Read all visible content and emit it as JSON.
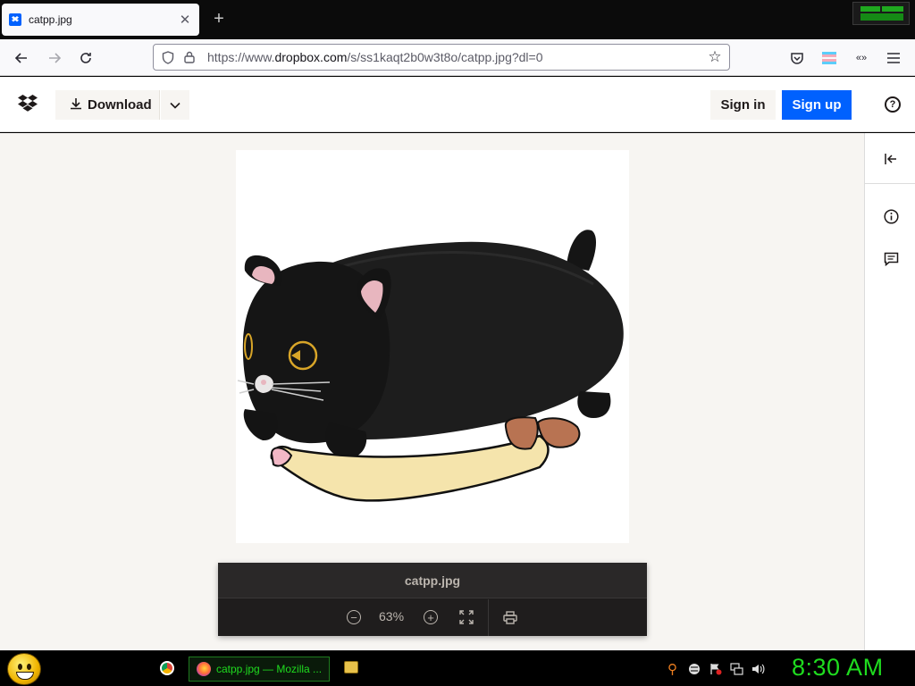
{
  "browser": {
    "tab_title": "catpp.jpg",
    "tab_close_glyph": "✕",
    "new_tab_glyph": "+",
    "url_prefix": "https://www.",
    "url_host": "dropbox.com",
    "url_path": "/s/ss1kaqt2b0w3t8o/catpp.jpg?dl=0"
  },
  "header": {
    "download_label": "Download",
    "sign_in_label": "Sign in",
    "sign_up_label": "Sign up",
    "help_glyph": "?"
  },
  "viewer": {
    "file_name": "catpp.jpg",
    "zoom_level": "63%"
  },
  "taskbar": {
    "firefox_label": "catpp.jpg — Mozilla ...",
    "clock": "8:30 AM"
  },
  "colors": {
    "dropbox_blue": "#0061fe",
    "taskbar_green": "#1fdc1f",
    "viewer_dark": "#1f1d1d"
  },
  "icons": [
    "dropbox-logo",
    "download-icon",
    "chevron-down-icon",
    "help-icon",
    "collapse-panel-icon",
    "info-icon",
    "comment-icon",
    "zoom-out-icon",
    "zoom-in-icon",
    "fullscreen-icon",
    "print-icon",
    "back-icon",
    "forward-icon",
    "reload-icon",
    "shield-icon",
    "lock-icon",
    "star-icon",
    "pocket-icon",
    "menu-icon"
  ]
}
